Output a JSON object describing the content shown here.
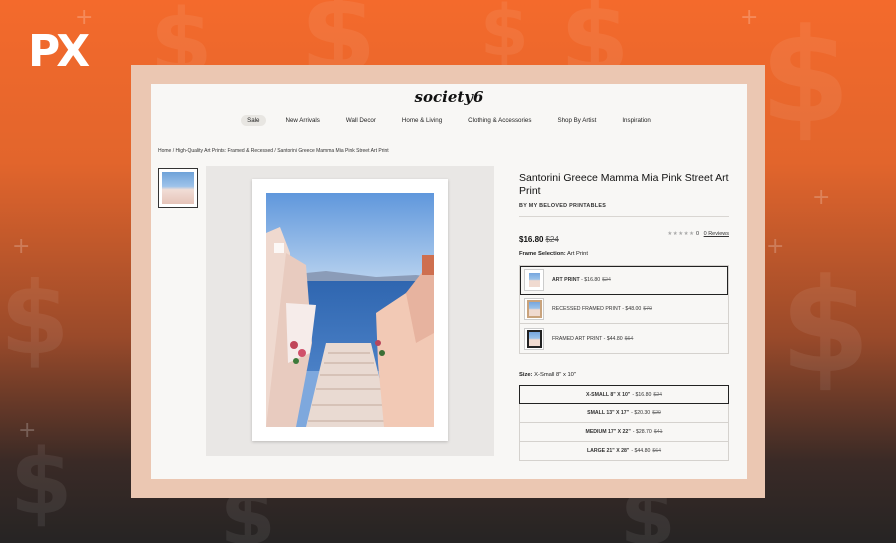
{
  "app": {
    "logo": "PX"
  },
  "site": {
    "brand": "society6",
    "nav": [
      "Sale",
      "New Arrivals",
      "Wall Decor",
      "Home & Living",
      "Clothing & Accessories",
      "Shop By Artist",
      "Inspiration"
    ],
    "breadcrumb": "Home / High-Quality Art Prints: Framed & Recessed / Santorini Greece Mamma Mia Pink Street Art Print"
  },
  "product": {
    "title": "Santorini Greece Mamma Mia Pink Street Art Print",
    "seller": "BY MY BELOVED PRINTABLES",
    "price": "$16.80",
    "old_price": "$24",
    "rating_count": "0",
    "reviews_link": "0 Reviews",
    "frame_label": "Frame Selection:",
    "frame_value": "Art Print",
    "frames": [
      {
        "name": "ART PRINT",
        "price": "- $16.80",
        "old": "$24"
      },
      {
        "name": "RECESSED FRAMED PRINT",
        "price": "- $48.00",
        "old": "$70"
      },
      {
        "name": "FRAMED ART PRINT",
        "price": "- $44.80",
        "old": "$64"
      }
    ],
    "size_label": "Size:",
    "size_value": "X-Small 8\" x 10\"",
    "sizes": [
      {
        "name": "X-SMALL 8\" X 10\"",
        "price": "- $16.80",
        "old": "$24"
      },
      {
        "name": "SMALL 13\" X 17\"",
        "price": "- $20.30",
        "old": "$29"
      },
      {
        "name": "MEDIUM 17\" X 22\"",
        "price": "- $28.70",
        "old": "$41"
      },
      {
        "name": "LARGE 21\" X 28\"",
        "price": "- $44.80",
        "old": "$64"
      }
    ]
  },
  "colors": {
    "accent_orange": "#f46a2c",
    "frame_peach": "#ebc7b2"
  }
}
